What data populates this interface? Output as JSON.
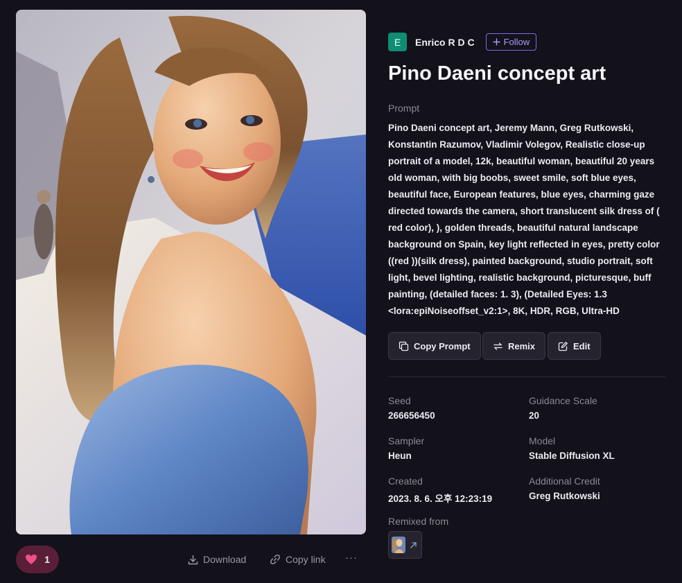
{
  "author": {
    "initial": "E",
    "name": "Enrico R D C",
    "follow_label": "Follow"
  },
  "title": "Pino Daeni concept art",
  "prompt": {
    "label": "Prompt",
    "text": "Pino Daeni concept art, Jeremy Mann, Greg Rutkowski, Konstantin Razumov, Vladimir Volegov, Realistic close-up portrait of a model, 12k, beautiful woman, beautiful 20 years old woman, with big boobs, sweet smile, soft blue eyes, beautiful face, European features, blue eyes, charming gaze directed towards the camera, short translucent silk dress of ( red color), ), golden threads, beautiful natural landscape background on Spain, key light reflected in eyes, pretty color ((red ))(silk dress), painted background, studio portrait, soft light, bevel lighting, realistic background, picturesque, buff painting, (detailed faces: 1. 3), (Detailed Eyes: 1.3 <lora:epiNoiseoffset_v2:1>, 8K, HDR, RGB, Ultra-HD"
  },
  "actions": {
    "copy_prompt": "Copy Prompt",
    "remix": "Remix",
    "edit": "Edit"
  },
  "meta": {
    "seed_label": "Seed",
    "seed": "266656450",
    "guidance_label": "Guidance Scale",
    "guidance": "20",
    "sampler_label": "Sampler",
    "sampler": "Heun",
    "model_label": "Model",
    "model": "Stable Diffusion XL",
    "created_label": "Created",
    "created": "2023. 8. 6. 오후 12:23:19",
    "credit_label": "Additional Credit",
    "credit": "Greg Rutkowski",
    "remixed_label": "Remixed from"
  },
  "bottom_bar": {
    "like_count": "1",
    "download_label": "Download",
    "copy_link_label": "Copy link",
    "more_label": "···"
  },
  "colors": {
    "background": "#13111a",
    "accent": "#7c6cf0",
    "avatar": "#0e8d74",
    "like": "#5a1f38",
    "heart": "#f0508a"
  },
  "icons": [
    "heart-icon",
    "download-icon",
    "link-icon",
    "more-icon",
    "plus-icon",
    "copy-icon",
    "remix-icon",
    "edit-icon",
    "external-link-icon"
  ]
}
